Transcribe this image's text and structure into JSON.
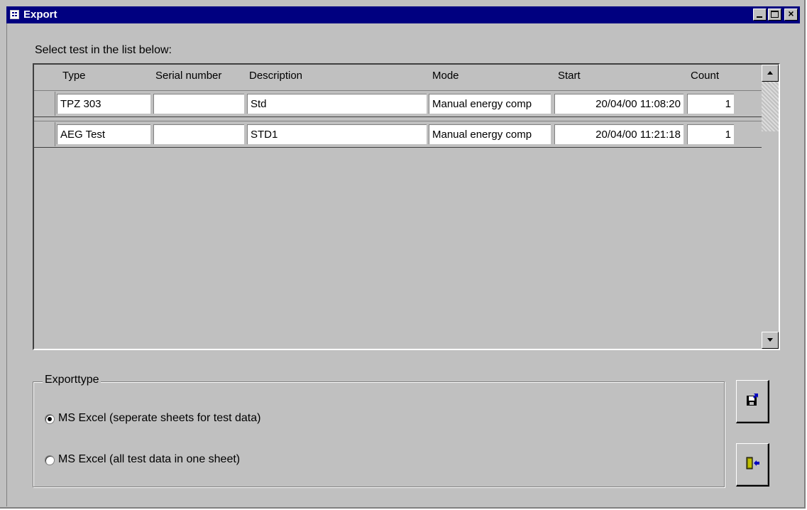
{
  "window": {
    "title": "Export"
  },
  "prompt": "Select test in the list below:",
  "columns": [
    "Type",
    "Serial number",
    "Description",
    "Mode",
    "Start",
    "Count"
  ],
  "rows": [
    {
      "type": "TPZ 303",
      "serial": "",
      "description": "Std",
      "mode": "Manual energy comp",
      "start": "20/04/00 11:08:20",
      "count": "1"
    },
    {
      "type": "AEG Test",
      "serial": "",
      "description": "STD1",
      "mode": "Manual energy comp",
      "start": "20/04/00 11:21:18",
      "count": "1"
    }
  ],
  "export_group": {
    "label": "Exporttype",
    "options": [
      {
        "label": "MS Excel (seperate sheets for test data)",
        "selected": true
      },
      {
        "label": "MS Excel (all test data in one sheet)",
        "selected": false
      }
    ]
  },
  "icons": {
    "title": "form-icon",
    "export": "save-export-icon",
    "exit": "exit-door-icon"
  }
}
